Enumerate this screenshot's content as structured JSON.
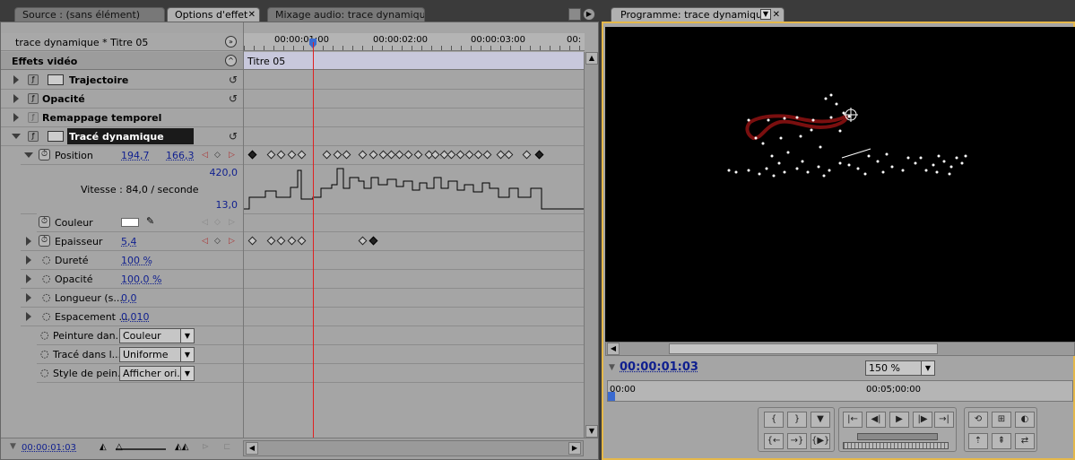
{
  "tabs": {
    "source": "Source : (sans élément)",
    "effect_options": "Options d'effet",
    "audio_mixer": "Mixage audio: trace dynamique",
    "program": "Programme: trace dynamique"
  },
  "effects": {
    "clip_name": "trace dynamique * Titre 05",
    "section_title": "Effets vidéo",
    "clip_label": "Titre 05",
    "items": {
      "trajectoire": "Trajectoire",
      "opacite": "Opacité",
      "remappage": "Remappage temporel",
      "trace": "Tracé dynamique"
    },
    "properties": {
      "position_label": "Position",
      "position_x": "194,7",
      "position_y": "166,3",
      "graph_max": "420,0",
      "graph_min": "13,0",
      "speed_label": "Vitesse : 84,0 / seconde",
      "couleur_label": "Couleur",
      "epaisseur_label": "Epaisseur",
      "epaisseur_val": "5,4",
      "durete_label": "Dureté",
      "durete_val": "100 %",
      "opacite_label": "Opacité",
      "opacite_val": "100,0 %",
      "longueur_label": "Longueur (s...",
      "longueur_val": "0,0",
      "espacement_label": "Espacement ...",
      "espacement_val": "0,010",
      "peinture_label": "Peinture dan...",
      "peinture_val": "Couleur",
      "trace_label": "Tracé dans l...",
      "trace_val": "Uniforme",
      "style_label": "Style de pein...",
      "style_val": "Afficher ori..."
    },
    "ruler": [
      "00:00:01:00",
      "00:00:02:00",
      "00:00:03:00",
      "00:"
    ],
    "timecode": "00:00:01:03"
  },
  "program": {
    "timecode": "00:00:01:03",
    "zoom": "150 %",
    "ruler_start": "00:00",
    "ruler_mid": "00:05;00:00"
  },
  "colors": {
    "accent_border": "#e5b84a",
    "playhead": "#e02020",
    "timecode": "#0f1f8f",
    "clip_bar": "#c8c8dc"
  }
}
